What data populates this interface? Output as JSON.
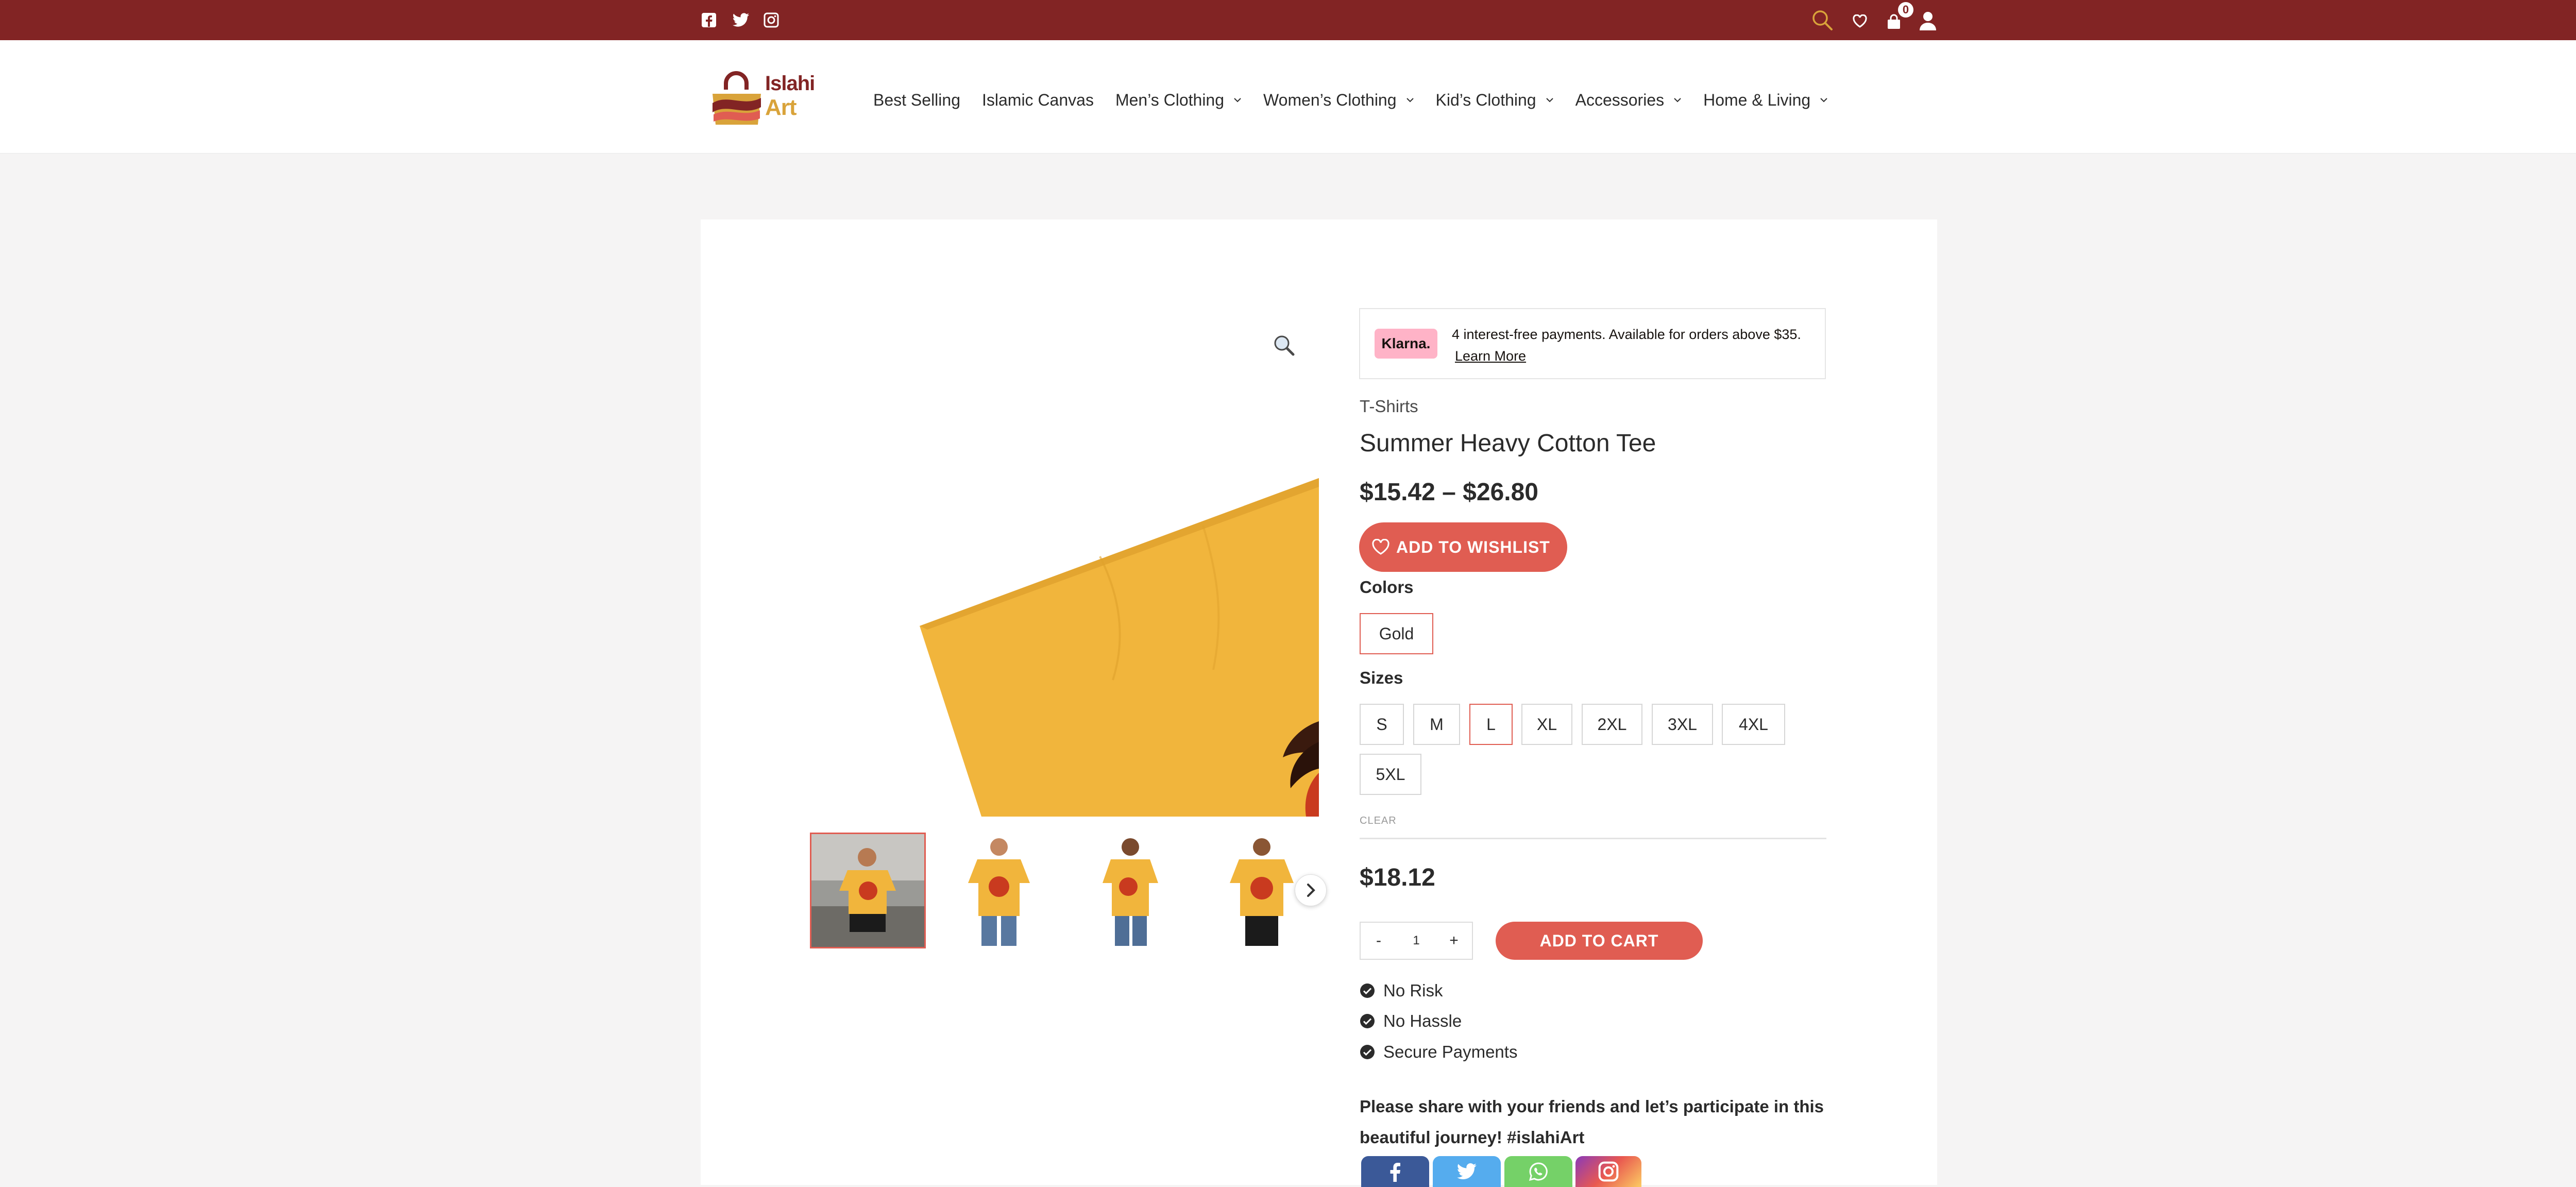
{
  "colors": {
    "topbar_bg": "#822424",
    "accent": "#e05d52",
    "search_icon": "#d9a33a",
    "logo_primary": "#822424",
    "logo_secondary": "#d9a33a",
    "klarna_pink": "#ffb3c7",
    "page_bg": "#f5f4f4"
  },
  "topbar": {
    "social_icons": [
      "facebook-square-icon",
      "twitter-icon",
      "instagram-icon"
    ],
    "cart_count": "0",
    "right_icons": [
      "search-icon",
      "heart-icon",
      "shopping-bag-icon",
      "user-icon"
    ]
  },
  "header": {
    "logo_text_1": "Islahi",
    "logo_text_2": "Art",
    "nav": [
      {
        "label": "Best Selling",
        "has_dropdown": false
      },
      {
        "label": "Islamic Canvas",
        "has_dropdown": false
      },
      {
        "label": "Men’s Clothing",
        "has_dropdown": true
      },
      {
        "label": "Women’s Clothing",
        "has_dropdown": true
      },
      {
        "label": "Kid’s Clothing",
        "has_dropdown": true
      },
      {
        "label": "Accessories",
        "has_dropdown": true
      },
      {
        "label": "Home & Living",
        "has_dropdown": true
      }
    ]
  },
  "gallery": {
    "thumbnails": [
      "man-sitting-yellow-tee",
      "man-front-yellow-tee",
      "man-side-yellow-tee",
      "man-standing-yellow-tee"
    ],
    "active_thumbnail": 0
  },
  "product": {
    "klarna_badge": "Klarna.",
    "klarna_text": "4 interest-free payments. Available for orders above $35.",
    "klarna_link": "Learn More",
    "category": "T-Shirts",
    "title": "Summer Heavy Cotton Tee",
    "price_range": "$15.42 – $26.80",
    "wishlist_label": "ADD TO WISHLIST",
    "colors_label": "Colors",
    "colors": [
      "Gold"
    ],
    "selected_color": "Gold",
    "sizes_label": "Sizes",
    "sizes": [
      "S",
      "M",
      "L",
      "XL",
      "2XL",
      "3XL",
      "4XL",
      "5XL"
    ],
    "selected_size": "L",
    "clear_label": "CLEAR",
    "variation_price": "$18.12",
    "qty_minus": "-",
    "qty_value": "1",
    "qty_plus": "+",
    "cart_label": "ADD TO CART",
    "features": [
      "No Risk",
      "No Hassle",
      "Secure Payments"
    ],
    "share_text": "Please share with your friends and let’s participate in this beautiful journey! #islahiArt",
    "share_buttons": [
      "facebook-share-icon",
      "twitter-share-icon",
      "whatsapp-share-icon",
      "instagram-share-icon"
    ]
  }
}
